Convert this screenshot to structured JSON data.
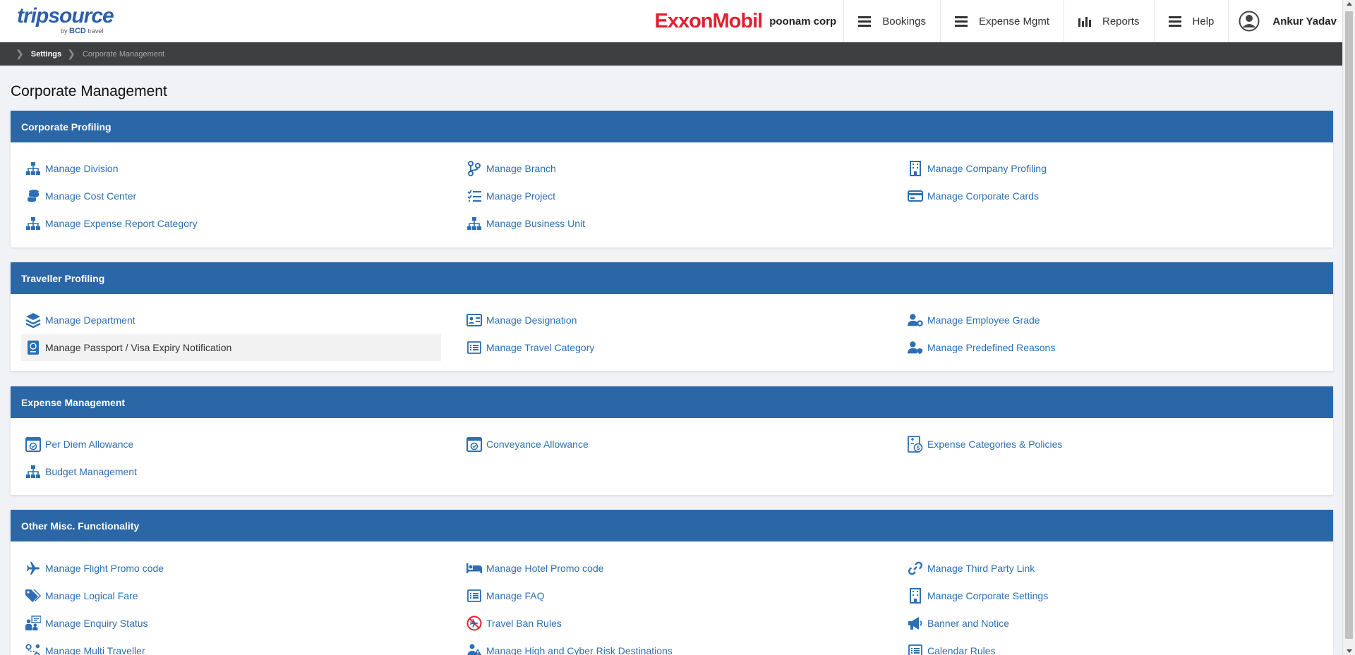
{
  "header": {
    "logo_main": "tripsource",
    "logo_by": "by",
    "logo_bcd": "BCD",
    "logo_travel": "travel",
    "brand": "ExxonMobil",
    "company": "poonam corp",
    "nav": [
      {
        "label": "Bookings",
        "icon": "menu-icon"
      },
      {
        "label": "Expense Mgmt",
        "icon": "menu-icon"
      },
      {
        "label": "Reports",
        "icon": "bar-chart-icon"
      },
      {
        "label": "Help",
        "icon": "menu-icon"
      }
    ],
    "user_name": "Ankur Yadav"
  },
  "breadcrumb": [
    "Settings",
    "Corporate Management"
  ],
  "page_title": "Corporate Management",
  "sections": [
    {
      "title": "Corporate Profiling",
      "items": [
        {
          "label": "Manage Division",
          "icon": "org-chart-icon"
        },
        {
          "label": "Manage Branch",
          "icon": "branch-icon"
        },
        {
          "label": "Manage Company Profiling",
          "icon": "building-icon"
        },
        {
          "label": "Manage Cost Center",
          "icon": "coins-icon"
        },
        {
          "label": "Manage Project",
          "icon": "checklist-icon"
        },
        {
          "label": "Manage Corporate Cards",
          "icon": "credit-card-icon"
        },
        {
          "label": "Manage Expense Report Category",
          "icon": "org-chart-icon"
        },
        {
          "label": "Manage Business Unit",
          "icon": "org-chart-icon"
        }
      ]
    },
    {
      "title": "Traveller Profiling",
      "items": [
        {
          "label": "Manage Department",
          "icon": "layers-icon"
        },
        {
          "label": "Manage Designation",
          "icon": "id-card-icon"
        },
        {
          "label": "Manage Employee Grade",
          "icon": "user-gear-icon"
        },
        {
          "label": "Manage Passport / Visa Expiry Notification",
          "icon": "passport-icon"
        },
        {
          "label": "Manage Travel Category",
          "icon": "list-icon"
        },
        {
          "label": "Manage Predefined Reasons",
          "icon": "user-shield-icon"
        }
      ]
    },
    {
      "title": "Expense Management",
      "items": [
        {
          "label": "Per Diem Allowance",
          "icon": "calendar-check-icon"
        },
        {
          "label": "Conveyance Allowance",
          "icon": "calendar-check-icon"
        },
        {
          "label": "Expense Categories & Policies",
          "icon": "expense-policy-icon"
        },
        {
          "label": "Budget Management",
          "icon": "org-chart-icon"
        }
      ]
    },
    {
      "title": "Other Misc. Functionality",
      "items": [
        {
          "label": "Manage Flight Promo code",
          "icon": "plane-icon"
        },
        {
          "label": "Manage Hotel Promo code",
          "icon": "bed-icon"
        },
        {
          "label": "Manage Third Party Link",
          "icon": "link-icon"
        },
        {
          "label": "Manage Logical Fare",
          "icon": "tags-icon"
        },
        {
          "label": "Manage FAQ",
          "icon": "list-icon"
        },
        {
          "label": "Manage Corporate Settings",
          "icon": "building-icon"
        },
        {
          "label": "Manage Enquiry Status",
          "icon": "people-board-icon"
        },
        {
          "label": "Travel Ban Rules",
          "icon": "no-plane-icon"
        },
        {
          "label": "Banner and Notice",
          "icon": "megaphone-icon"
        },
        {
          "label": "Manage Multi Traveller",
          "icon": "route-icon"
        },
        {
          "label": "Manage High and Cyber Risk Destinations",
          "icon": "risk-icon"
        },
        {
          "label": "Calendar Rules",
          "icon": "list-icon"
        }
      ]
    }
  ],
  "colors": {
    "primary": "#2b67a6",
    "link": "#2c6fb3",
    "brand_red": "#e4202e",
    "breadcrumb_bg": "#3d3f41"
  }
}
